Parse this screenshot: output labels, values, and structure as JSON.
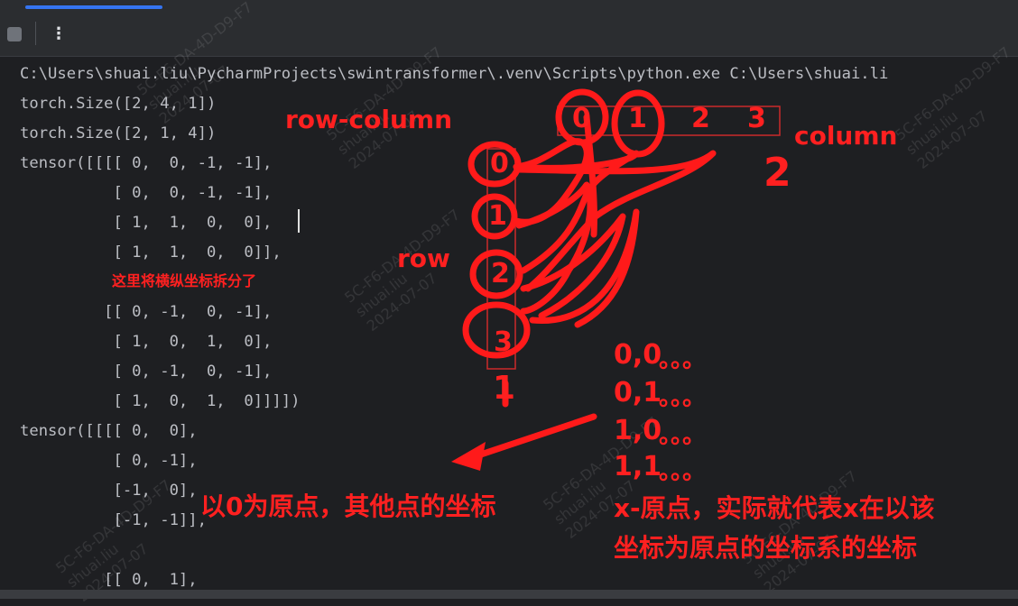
{
  "console": {
    "lines": [
      "C:\\Users\\shuai.liu\\PycharmProjects\\swintransformer\\.venv\\Scripts\\python.exe C:\\Users\\shuai.li",
      "torch.Size([2, 4, 1])",
      "torch.Size([2, 1, 4])",
      "tensor([[[[ 0,  0, -1, -1],",
      "          [ 0,  0, -1, -1],",
      "          [ 1,  1,  0,  0],",
      "          [ 1,  1,  0,  0]],",
      "",
      "         [[ 0, -1,  0, -1],",
      "          [ 1,  0,  1,  0],",
      "          [ 0, -1,  0, -1],",
      "          [ 1,  0,  1,  0]]]])",
      "tensor([[[[ 0,  0],",
      "          [ 0, -1],",
      "          [-1,  0],",
      "          [-1, -1]],",
      "",
      "         [[ 0,  1],"
    ]
  },
  "annotations": {
    "row_column": "row-column",
    "column": "column",
    "row": "row",
    "col_nums": [
      "0",
      "1",
      "2",
      "3"
    ],
    "row_nums": [
      "0",
      "1",
      "2",
      "3"
    ],
    "two": "2",
    "one": "1",
    "split_note": "这里将横纵坐标拆分了",
    "coords": [
      "0,0",
      "0,1",
      "1,0",
      "1,1"
    ],
    "dots": "。。。",
    "origin_note": "以0为原点，其他点的坐标",
    "x_note_line1": "x-原点，实际就代表x在以该",
    "x_note_line2": "坐标为原点的坐标系的坐标"
  },
  "watermark": {
    "text": "5C-F6-DA-4D-D9-F7\nshuai.liu\n2024-07-07"
  },
  "colors": {
    "annotation": "#ff2020",
    "console_text": "#bcbec4",
    "background": "#1e1f22",
    "accent": "#3574f0"
  }
}
